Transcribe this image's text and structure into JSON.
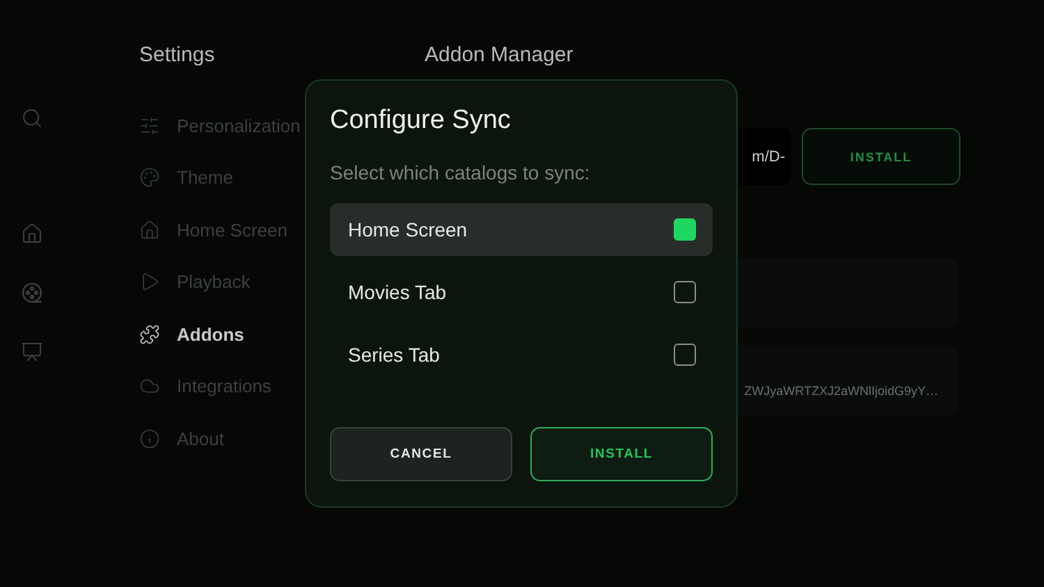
{
  "sidebar": {
    "title": "Settings",
    "items": [
      {
        "label": "Personalization",
        "selected": false
      },
      {
        "label": "Theme",
        "selected": false
      },
      {
        "label": "Home Screen",
        "selected": false
      },
      {
        "label": "Playback",
        "selected": false
      },
      {
        "label": "Addons",
        "selected": true
      },
      {
        "label": "Integrations",
        "selected": false
      },
      {
        "label": "About",
        "selected": false
      }
    ]
  },
  "main": {
    "title": "Addon Manager",
    "url_field": {
      "value": "m/D-"
    },
    "install_button": "INSTALL",
    "addon_cards": [
      {
        "kind": "blank"
      },
      {
        "kind": "text",
        "text": "ZWJyaWRTZXJ2aWNlIjoidG9yY…"
      }
    ]
  },
  "dialog": {
    "title": "Configure Sync",
    "subtitle": "Select which catalogs to sync:",
    "options": [
      {
        "label": "Home Screen",
        "checked": true,
        "focused": true
      },
      {
        "label": "Movies Tab",
        "checked": false,
        "focused": false
      },
      {
        "label": "Series Tab",
        "checked": false,
        "focused": false
      }
    ],
    "buttons": [
      {
        "label": "CANCEL",
        "kind": "cancel"
      },
      {
        "label": "INSTALL",
        "kind": "primary"
      }
    ]
  }
}
